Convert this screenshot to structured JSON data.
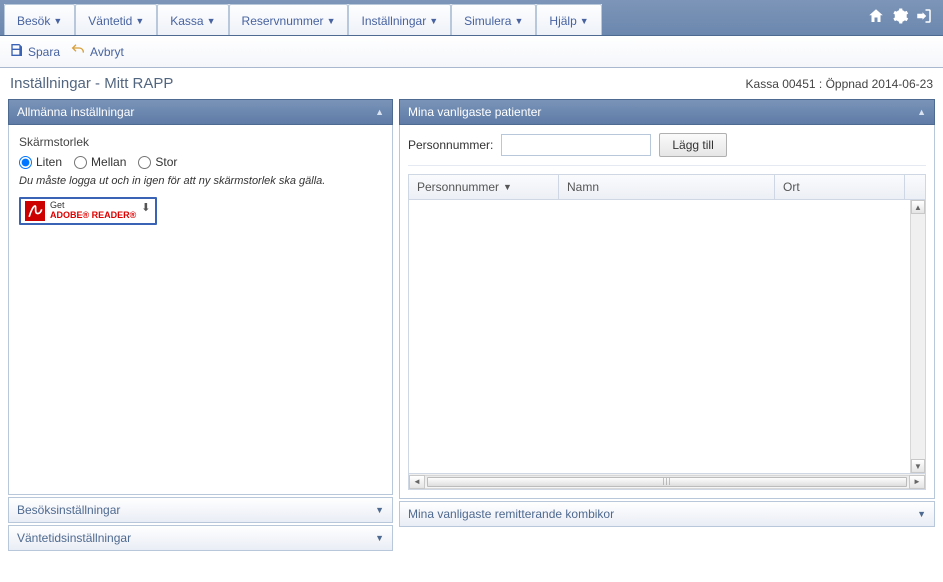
{
  "menu": {
    "items": [
      {
        "label": "Besök"
      },
      {
        "label": "Väntetid"
      },
      {
        "label": "Kassa"
      },
      {
        "label": "Reservnummer"
      },
      {
        "label": "Inställningar"
      },
      {
        "label": "Simulera"
      },
      {
        "label": "Hjälp"
      }
    ]
  },
  "toolbar": {
    "save": "Spara",
    "cancel": "Avbryt"
  },
  "page": {
    "title": "Inställningar - Mitt RAPP",
    "status": "Kassa 00451 : Öppnad 2014-06-23"
  },
  "left": {
    "general": {
      "title": "Allmänna inställningar",
      "screensize_label": "Skärmstorlek",
      "options": {
        "small": "Liten",
        "medium": "Mellan",
        "large": "Stor"
      },
      "hint": "Du måste logga ut och in igen för att ny skärmstorlek ska gälla.",
      "adobe_get": "Get",
      "adobe_name": "ADOBE® READER®"
    },
    "visits_title": "Besöksinställningar",
    "wait_title": "Väntetidsinställningar"
  },
  "right": {
    "patients": {
      "title": "Mina vanligaste patienter",
      "pn_label": "Personnummer:",
      "add_label": "Lägg till",
      "columns": {
        "pn": "Personnummer",
        "name": "Namn",
        "city": "Ort"
      }
    },
    "referrers_title": "Mina vanligaste remitterande kombikor"
  }
}
